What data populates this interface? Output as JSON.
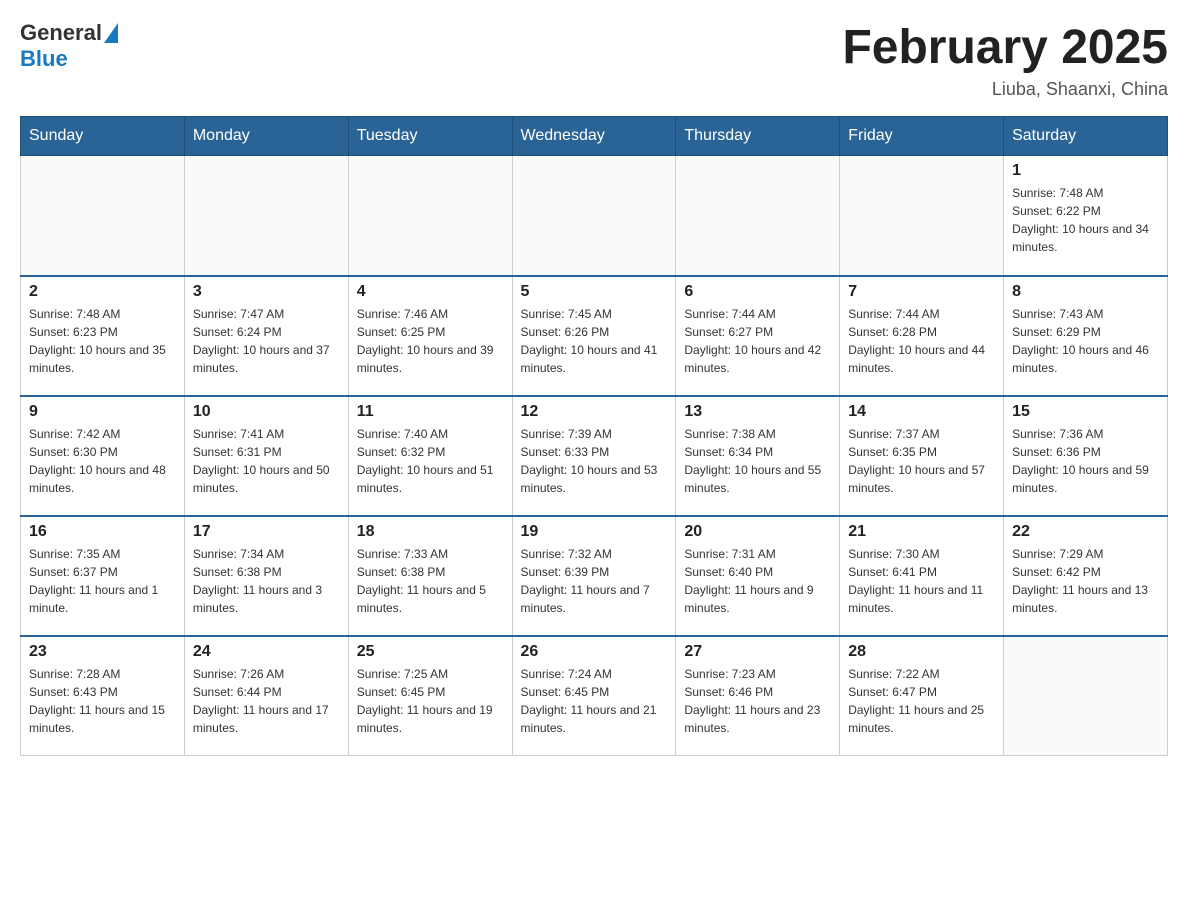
{
  "header": {
    "logo_general": "General",
    "logo_blue": "Blue",
    "title": "February 2025",
    "subtitle": "Liuba, Shaanxi, China"
  },
  "days_of_week": [
    "Sunday",
    "Monday",
    "Tuesday",
    "Wednesday",
    "Thursday",
    "Friday",
    "Saturday"
  ],
  "weeks": [
    [
      {
        "day": "",
        "info": ""
      },
      {
        "day": "",
        "info": ""
      },
      {
        "day": "",
        "info": ""
      },
      {
        "day": "",
        "info": ""
      },
      {
        "day": "",
        "info": ""
      },
      {
        "day": "",
        "info": ""
      },
      {
        "day": "1",
        "info": "Sunrise: 7:48 AM\nSunset: 6:22 PM\nDaylight: 10 hours and 34 minutes."
      }
    ],
    [
      {
        "day": "2",
        "info": "Sunrise: 7:48 AM\nSunset: 6:23 PM\nDaylight: 10 hours and 35 minutes."
      },
      {
        "day": "3",
        "info": "Sunrise: 7:47 AM\nSunset: 6:24 PM\nDaylight: 10 hours and 37 minutes."
      },
      {
        "day": "4",
        "info": "Sunrise: 7:46 AM\nSunset: 6:25 PM\nDaylight: 10 hours and 39 minutes."
      },
      {
        "day": "5",
        "info": "Sunrise: 7:45 AM\nSunset: 6:26 PM\nDaylight: 10 hours and 41 minutes."
      },
      {
        "day": "6",
        "info": "Sunrise: 7:44 AM\nSunset: 6:27 PM\nDaylight: 10 hours and 42 minutes."
      },
      {
        "day": "7",
        "info": "Sunrise: 7:44 AM\nSunset: 6:28 PM\nDaylight: 10 hours and 44 minutes."
      },
      {
        "day": "8",
        "info": "Sunrise: 7:43 AM\nSunset: 6:29 PM\nDaylight: 10 hours and 46 minutes."
      }
    ],
    [
      {
        "day": "9",
        "info": "Sunrise: 7:42 AM\nSunset: 6:30 PM\nDaylight: 10 hours and 48 minutes."
      },
      {
        "day": "10",
        "info": "Sunrise: 7:41 AM\nSunset: 6:31 PM\nDaylight: 10 hours and 50 minutes."
      },
      {
        "day": "11",
        "info": "Sunrise: 7:40 AM\nSunset: 6:32 PM\nDaylight: 10 hours and 51 minutes."
      },
      {
        "day": "12",
        "info": "Sunrise: 7:39 AM\nSunset: 6:33 PM\nDaylight: 10 hours and 53 minutes."
      },
      {
        "day": "13",
        "info": "Sunrise: 7:38 AM\nSunset: 6:34 PM\nDaylight: 10 hours and 55 minutes."
      },
      {
        "day": "14",
        "info": "Sunrise: 7:37 AM\nSunset: 6:35 PM\nDaylight: 10 hours and 57 minutes."
      },
      {
        "day": "15",
        "info": "Sunrise: 7:36 AM\nSunset: 6:36 PM\nDaylight: 10 hours and 59 minutes."
      }
    ],
    [
      {
        "day": "16",
        "info": "Sunrise: 7:35 AM\nSunset: 6:37 PM\nDaylight: 11 hours and 1 minute."
      },
      {
        "day": "17",
        "info": "Sunrise: 7:34 AM\nSunset: 6:38 PM\nDaylight: 11 hours and 3 minutes."
      },
      {
        "day": "18",
        "info": "Sunrise: 7:33 AM\nSunset: 6:38 PM\nDaylight: 11 hours and 5 minutes."
      },
      {
        "day": "19",
        "info": "Sunrise: 7:32 AM\nSunset: 6:39 PM\nDaylight: 11 hours and 7 minutes."
      },
      {
        "day": "20",
        "info": "Sunrise: 7:31 AM\nSunset: 6:40 PM\nDaylight: 11 hours and 9 minutes."
      },
      {
        "day": "21",
        "info": "Sunrise: 7:30 AM\nSunset: 6:41 PM\nDaylight: 11 hours and 11 minutes."
      },
      {
        "day": "22",
        "info": "Sunrise: 7:29 AM\nSunset: 6:42 PM\nDaylight: 11 hours and 13 minutes."
      }
    ],
    [
      {
        "day": "23",
        "info": "Sunrise: 7:28 AM\nSunset: 6:43 PM\nDaylight: 11 hours and 15 minutes."
      },
      {
        "day": "24",
        "info": "Sunrise: 7:26 AM\nSunset: 6:44 PM\nDaylight: 11 hours and 17 minutes."
      },
      {
        "day": "25",
        "info": "Sunrise: 7:25 AM\nSunset: 6:45 PM\nDaylight: 11 hours and 19 minutes."
      },
      {
        "day": "26",
        "info": "Sunrise: 7:24 AM\nSunset: 6:45 PM\nDaylight: 11 hours and 21 minutes."
      },
      {
        "day": "27",
        "info": "Sunrise: 7:23 AM\nSunset: 6:46 PM\nDaylight: 11 hours and 23 minutes."
      },
      {
        "day": "28",
        "info": "Sunrise: 7:22 AM\nSunset: 6:47 PM\nDaylight: 11 hours and 25 minutes."
      },
      {
        "day": "",
        "info": ""
      }
    ]
  ]
}
